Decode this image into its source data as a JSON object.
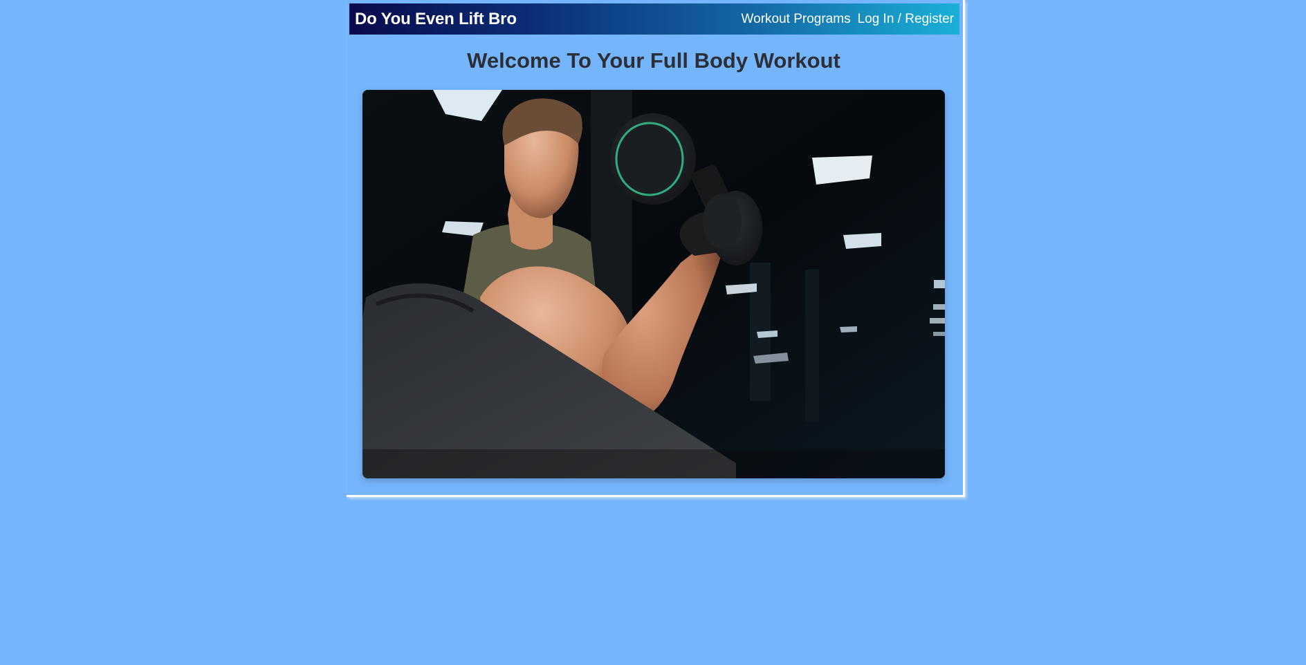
{
  "header": {
    "brand": "Do You Even Lift Bro",
    "nav": [
      {
        "label": "Workout Programs"
      },
      {
        "label": "Log In / Register"
      }
    ]
  },
  "main": {
    "title": "Welcome To Your Full Body Workout",
    "hero_image": {
      "subject": "man-curling-dumbbell-on-preacher-bench"
    }
  },
  "colors": {
    "background": "#75b5fc",
    "navbar_start": "#0a0a4c",
    "navbar_end": "#1ab0d8",
    "title_text": "#2c2f36",
    "accent_ring": "#2fae7e"
  }
}
